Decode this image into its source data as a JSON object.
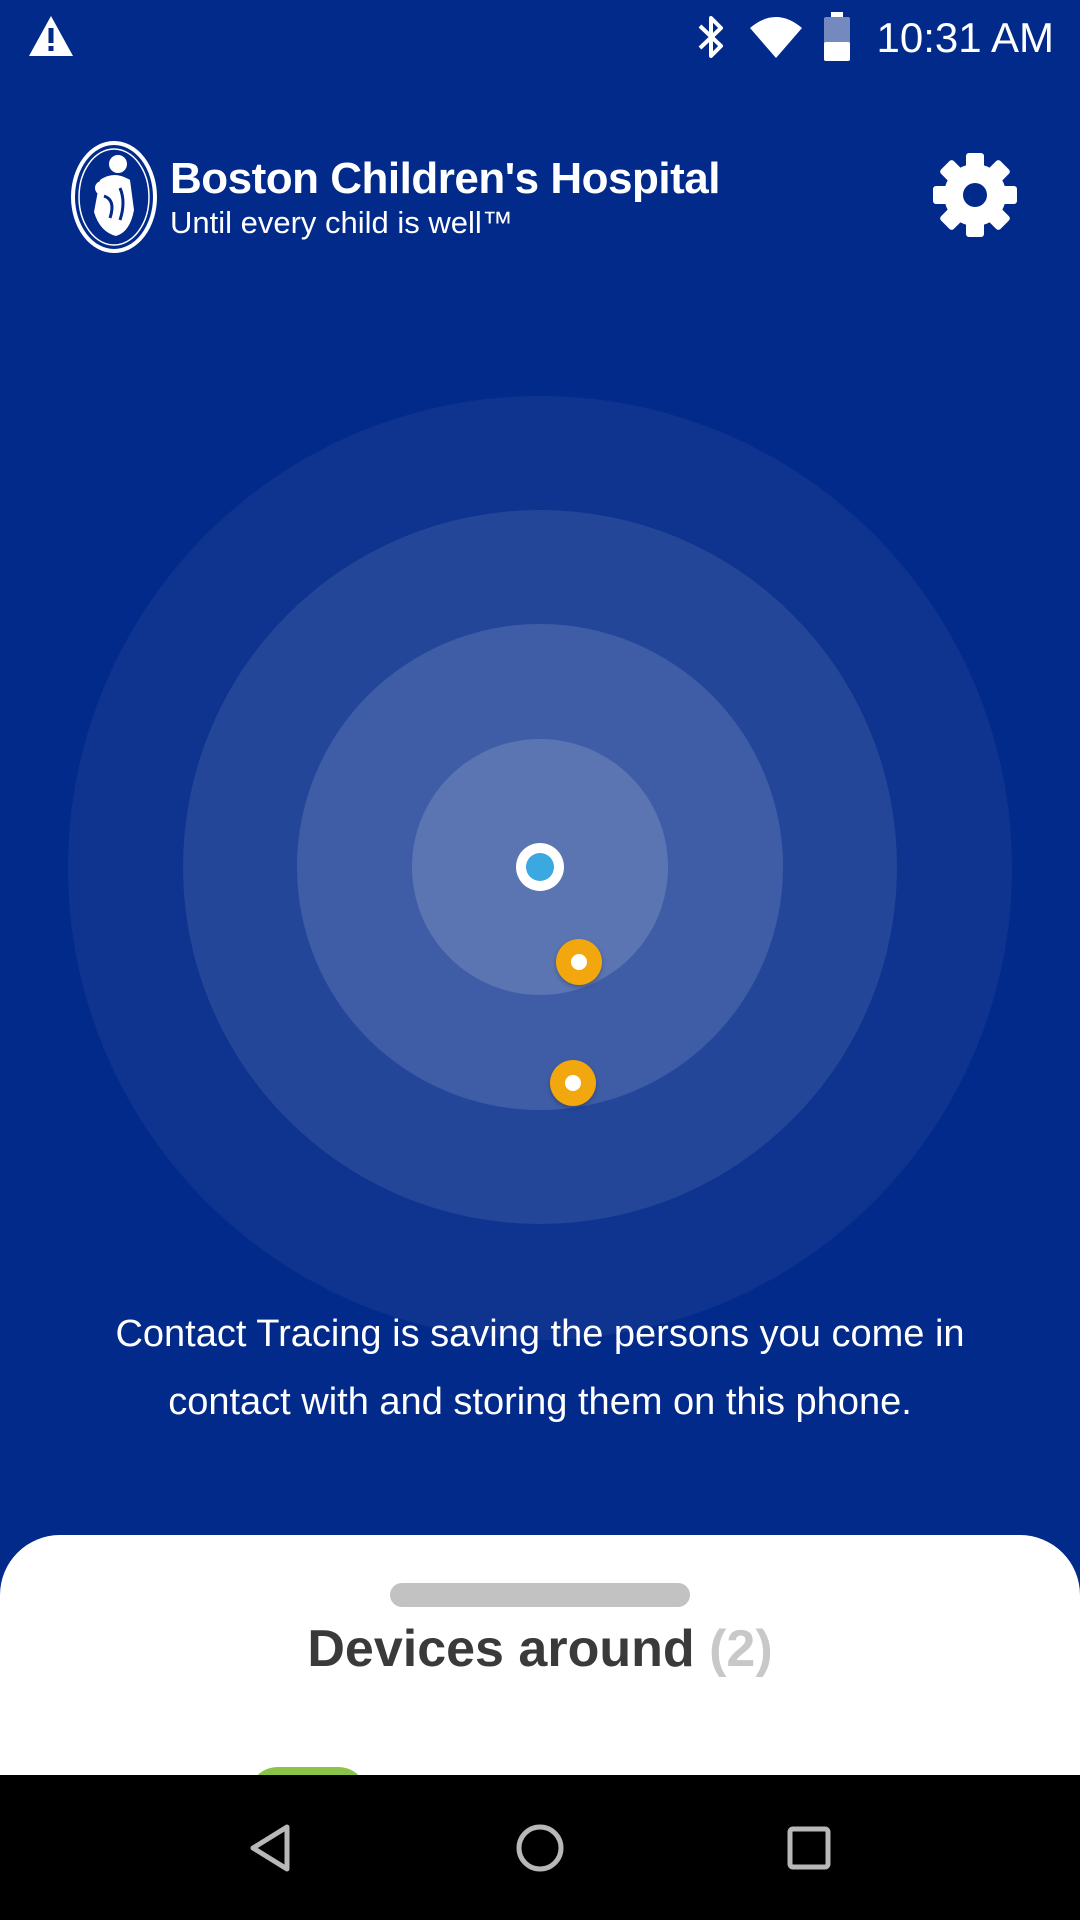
{
  "status_bar": {
    "time": "10:31 AM",
    "icons": [
      "warning-icon",
      "bluetooth-icon",
      "wifi-icon",
      "battery-icon"
    ]
  },
  "header": {
    "brand_name": "Boston Children's Hospital",
    "tagline": "Until every child is well™",
    "settings_icon": "gear-icon"
  },
  "radar": {
    "self_color": "#3ba8e0",
    "device_color": "#f2a70f",
    "devices_shown": 2
  },
  "info_text": "Contact Tracing is saving the persons you come in contact with and storing them on this phone.",
  "sheet": {
    "title": "Devices around",
    "count": "(2)"
  },
  "nav_bar": {
    "buttons": [
      "back-icon",
      "home-icon",
      "recents-icon"
    ]
  },
  "colors": {
    "background": "#022a8a",
    "accent": "#f2a70f",
    "self": "#3ba8e0"
  }
}
